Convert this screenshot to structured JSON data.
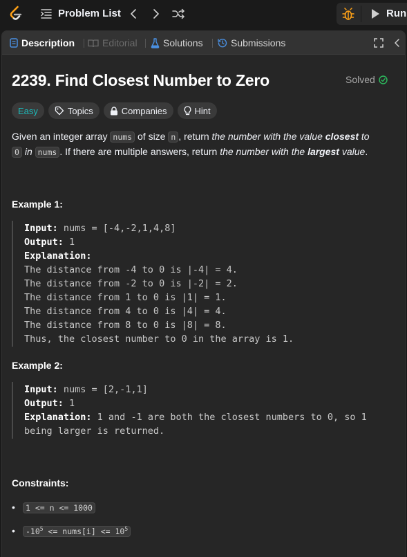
{
  "topbar": {
    "problem_list_label": "Problem List",
    "run_label": "Run"
  },
  "tabs": {
    "description": "Description",
    "editorial": "Editorial",
    "solutions": "Solutions",
    "submissions": "Submissions"
  },
  "problem": {
    "title": "2239. Find Closest Number to Zero",
    "status": "Solved",
    "difficulty": "Easy",
    "tag_topics": "Topics",
    "tag_companies": "Companies",
    "tag_hint": "Hint"
  },
  "description": {
    "p1": "Given an integer array ",
    "code_nums": "nums",
    "p2": " of size ",
    "code_n": "n",
    "p3": ", return ",
    "i1": "the number with the value ",
    "b1": "closest",
    "i2": " to",
    "code_zero": "0",
    "i3": " in ",
    "code_nums2": "nums",
    "p4": ". If there are multiple answers, return ",
    "i4": "the number with the ",
    "b2": "largest",
    "i5": " value",
    "p5": "."
  },
  "example1": {
    "title": "Example 1:",
    "input_label": "Input:",
    "input_value": " nums = [-4,-2,1,4,8]",
    "output_label": "Output:",
    "output_value": " 1",
    "explanation_label": "Explanation:",
    "lines": [
      "The distance from -4 to 0 is |-4| = 4.",
      "The distance from -2 to 0 is |-2| = 2.",
      "The distance from 1 to 0 is |1| = 1.",
      "The distance from 4 to 0 is |4| = 4.",
      "The distance from 8 to 0 is |8| = 8.",
      "Thus, the closest number to 0 in the array is 1."
    ]
  },
  "example2": {
    "title": "Example 2:",
    "input_label": "Input:",
    "input_value": " nums = [2,-1,1]",
    "output_label": "Output:",
    "output_value": " 1",
    "explanation_label": "Explanation:",
    "explanation_line1": " 1 and -1 are both the closest numbers to 0, so 1",
    "explanation_line2": "being larger is returned."
  },
  "constraints": {
    "title": "Constraints:",
    "c1": "1 <= n <= 1000",
    "c2_pre": "-10",
    "c2_sup1": "5",
    "c2_mid": " <= nums[i] <= 10",
    "c2_sup2": "5"
  },
  "colors": {
    "easy": "#1cbaba",
    "solved_check": "#2cbb5d",
    "accent_blue": "#4a90e2",
    "logo_orange": "#ffa116"
  }
}
